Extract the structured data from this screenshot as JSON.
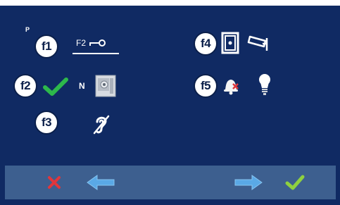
{
  "screen": {
    "p_label": "P",
    "f_buttons": {
      "f1": "f1",
      "f2": "f2",
      "f3": "f3",
      "f4": "f4",
      "f5": "f5"
    },
    "f1_label": "F2",
    "n_label": "N",
    "icons": {
      "f1": "key-icon",
      "f2": [
        "check-icon",
        "camera-panel-icon"
      ],
      "f3": "hearing-loop-icon",
      "f4": [
        "door-icon",
        "cctv-camera-icon"
      ],
      "f5": [
        "bell-muted-icon",
        "light-bulb-icon"
      ]
    }
  },
  "bottom_bar": {
    "icons": [
      "close-icon",
      "arrow-left-icon",
      "arrow-right-icon",
      "confirm-check-icon"
    ]
  },
  "colors": {
    "background": "#102a63",
    "bottom_bar": "#3d5f8f",
    "accent_green": "#2db84b",
    "cancel_red": "#e0363c",
    "arrow_blue": "#5aa9e6"
  }
}
